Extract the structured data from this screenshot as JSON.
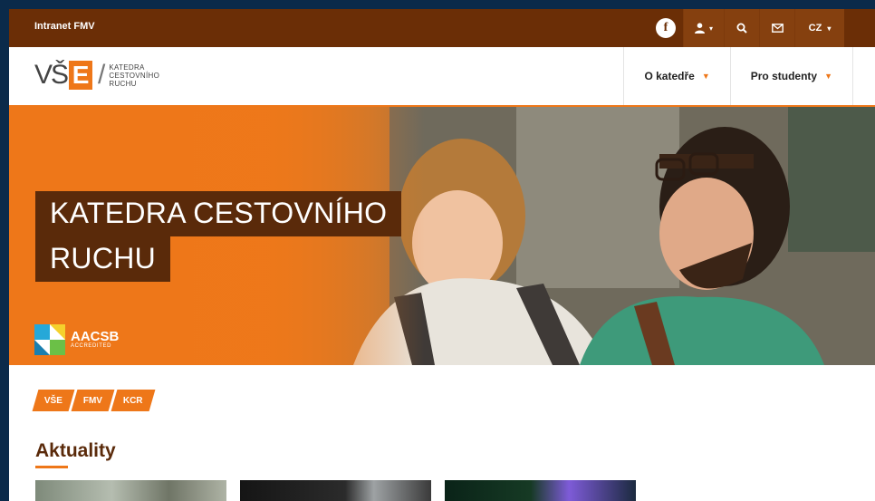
{
  "topbar": {
    "intranet_label": "Intranet FMV",
    "lang_label": "CZ",
    "icons": [
      "facebook-icon",
      "user-icon",
      "search-icon",
      "mail-icon"
    ]
  },
  "header": {
    "logo": {
      "line1": "KATEDRA",
      "line2": "CESTOVNÍHO",
      "line3": "RUCHU"
    },
    "nav": [
      {
        "label": "O katedře"
      },
      {
        "label": "Pro studenty"
      }
    ]
  },
  "hero": {
    "title_line1": "KATEDRA CESTOVNÍHO",
    "title_line2": "RUCHU",
    "badge_main": "AACSB",
    "badge_sub": "ACCREDITED"
  },
  "breadcrumb": [
    "VŠE",
    "FMV",
    "KCR"
  ],
  "news": {
    "title": "Aktuality"
  },
  "colors": {
    "topbar": "#6b2e06",
    "accent": "#ee7719",
    "title_box": "#5a2a0a"
  }
}
